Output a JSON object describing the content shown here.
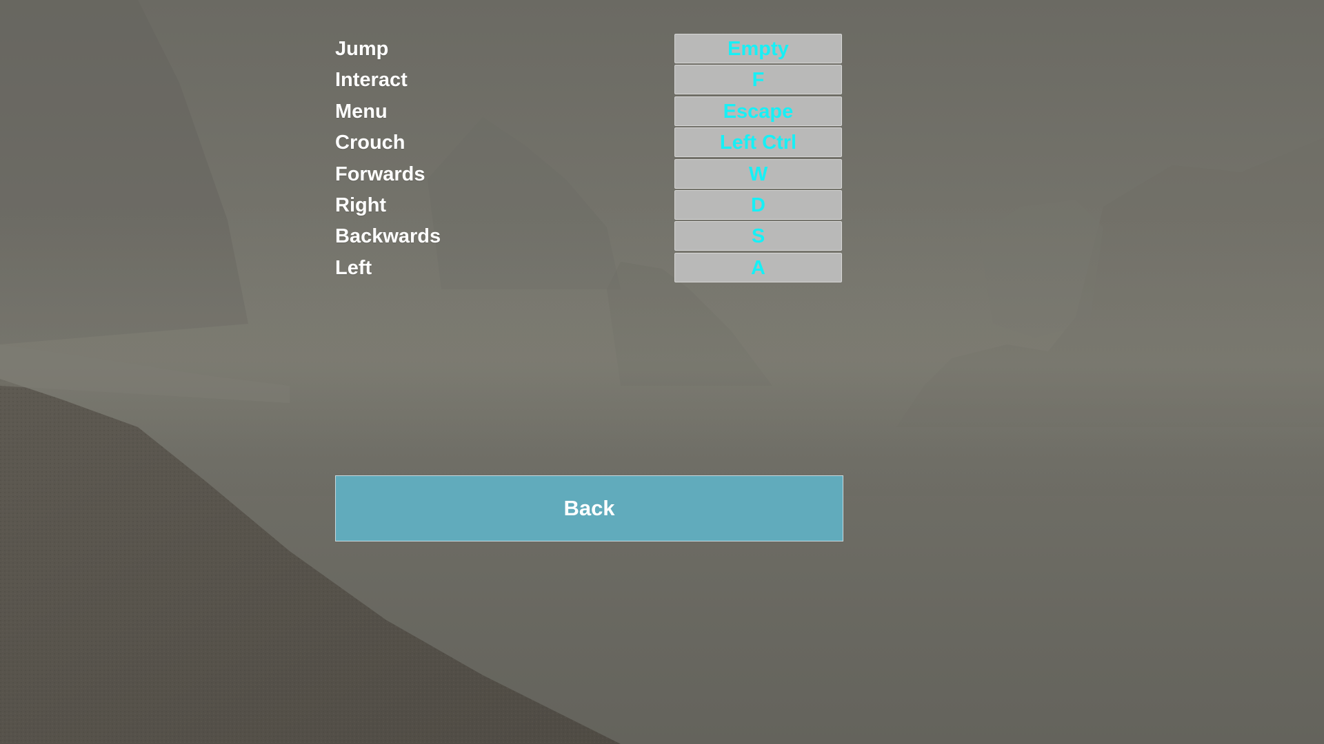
{
  "menu": {
    "bindings": [
      {
        "action": "Jump",
        "key": "Empty"
      },
      {
        "action": "Interact",
        "key": "F"
      },
      {
        "action": "Menu",
        "key": "Escape"
      },
      {
        "action": "Crouch",
        "key": "Left Ctrl"
      },
      {
        "action": "Forwards",
        "key": "W"
      },
      {
        "action": "Right",
        "key": "D"
      },
      {
        "action": "Backwards",
        "key": "S"
      },
      {
        "action": "Left",
        "key": "A"
      }
    ],
    "back_label": "Back"
  },
  "colors": {
    "label_text": "#ffffff",
    "key_text": "#16f0f6",
    "key_background": "#b9b9b8",
    "back_background": "#61abbc"
  }
}
